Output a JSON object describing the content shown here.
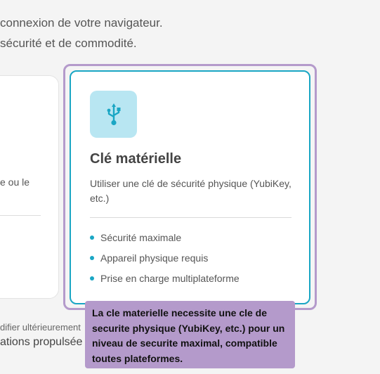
{
  "intro": {
    "line1": "connexion de votre navigateur.",
    "line2": "sécurité et de commodité."
  },
  "left_card": {
    "desc_fragment": "e ou le"
  },
  "hardware_key_card": {
    "icon": "usb-icon",
    "title": "Clé matérielle",
    "description": "Utiliser une clé de sécurité physique (YubiKey, etc.)",
    "features": [
      "Sécurité maximale",
      "Appareil physique requis",
      "Prise en charge multiplateforme"
    ]
  },
  "footer": {
    "line1": "difier ultérieurement",
    "line2": "ations propulsée"
  },
  "tooltip": {
    "text": "La cle materielle necessite une cle de securite physique (YubiKey, etc.) pour un niveau de securite maximal, compatible toutes plateformes."
  },
  "colors": {
    "accent": "#1aa6c4",
    "focus_ring": "#b49acb",
    "icon_badge": "#b8e6f2",
    "tooltip_bg": "#b49acb"
  }
}
